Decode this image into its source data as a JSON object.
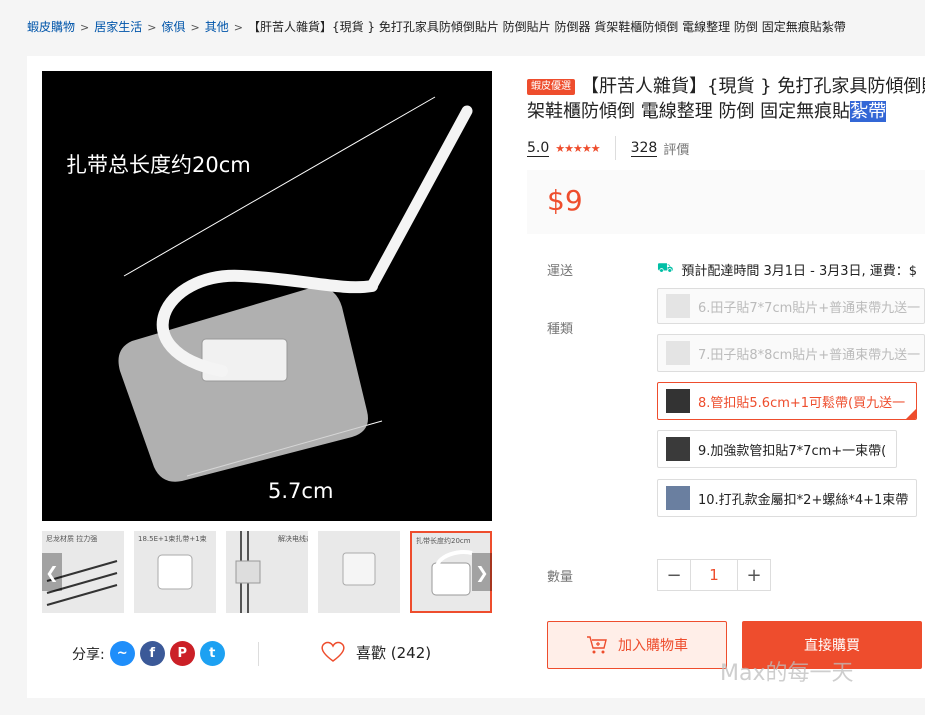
{
  "breadcrumb": {
    "items": [
      "蝦皮購物",
      "居家生活",
      "傢俱",
      "其他"
    ],
    "current": "【肝苦人雜貨】{現貨 } 免打孔家具防傾倒貼片 防倒貼片 防倒器 貨架鞋櫃防傾倒 電線整理 防倒 固定無痕貼紮帶"
  },
  "product": {
    "badge": "蝦皮優選",
    "title_line1": "【肝苦人雜貨】{現貨 } 免打孔家具防傾倒貼片 防倒貼片 防倒器 貨",
    "title_line2": "架鞋櫃防傾倒 電線整理 防倒 固定無痕貼",
    "title_highlight": "紮帶",
    "rating": "5.0",
    "stars": "★★★★★",
    "review_count": "328",
    "review_label": "評價",
    "price": "$9"
  },
  "gallery": {
    "main_caption_top": "扎带总长度约20cm",
    "main_caption_bottom": "5.7cm",
    "thumbs": [
      {
        "label": "尼龙材质 拉力强"
      },
      {
        "label": "18.5E+1束扎带+1束"
      },
      {
        "label": "解决电线杂乱"
      },
      {
        "label": ""
      },
      {
        "label": "扎带长度约20cm"
      }
    ]
  },
  "shipping": {
    "label": "運送",
    "text": "預計配達時間 3月1日 - 3月3日, 運費：$"
  },
  "variants": {
    "label": "種類",
    "items": [
      {
        "label": "6.田子貼7*7cm貼片+普通束帶九送一",
        "state": "disabled"
      },
      {
        "label": "7.田子貼8*8cm貼片+普通束帶九送一",
        "state": "disabled"
      },
      {
        "label": "8.管扣貼5.6cm+1可鬆帶(買九送一",
        "state": "selected"
      },
      {
        "label": "9.加強款管扣貼7*7cm+一束帶(",
        "state": "normal"
      },
      {
        "label": "10.打孔款金屬扣*2+螺絲*4+1束帶",
        "state": "normal"
      }
    ]
  },
  "quantity": {
    "label": "數量",
    "minus": "−",
    "value": "1",
    "plus": "+"
  },
  "actions": {
    "add_to_cart": "加入購物車",
    "buy_now": "直接購買"
  },
  "social": {
    "share_label": "分享:",
    "like_label": "喜歡 (242)"
  },
  "watermark": "Max的每一天",
  "colors": {
    "accent": "#ee4d2d",
    "link": "#0055aa",
    "messenger": "#1f8efa",
    "facebook": "#3b5998",
    "pinterest": "#cb2027",
    "twitter": "#1da1f2"
  }
}
